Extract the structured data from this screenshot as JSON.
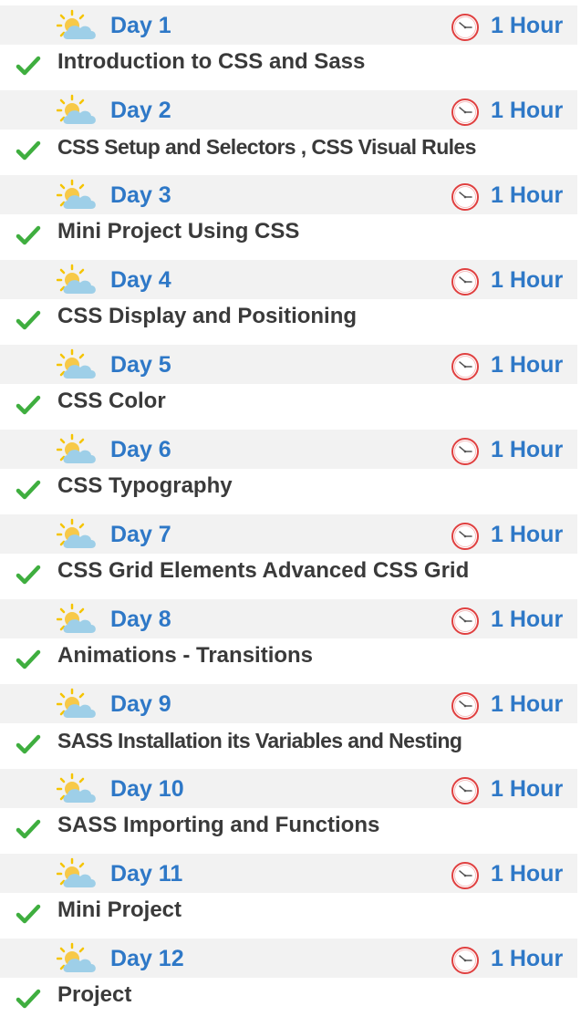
{
  "colors": {
    "accent": "#2e78c7",
    "header_bg": "#f2f2f2",
    "check": "#3fae3f",
    "clock": "#e04040",
    "text": "#3a3a3a"
  },
  "icons": {
    "weather": "sun-behind-cloud-icon",
    "time": "clock-icon",
    "done": "checkmark-icon"
  },
  "days": [
    {
      "label": "Day 1",
      "duration": "1 Hour",
      "topic": "Introduction to CSS and Sass"
    },
    {
      "label": "Day 2",
      "duration": "1 Hour",
      "topic": "CSS Setup and Selectors , CSS Visual Rules"
    },
    {
      "label": "Day 3",
      "duration": "1 Hour",
      "topic": "Mini Project Using CSS"
    },
    {
      "label": "Day 4",
      "duration": "1 Hour",
      "topic": "CSS Display and Positioning"
    },
    {
      "label": "Day 5",
      "duration": "1 Hour",
      "topic": "CSS Color"
    },
    {
      "label": "Day 6",
      "duration": "1 Hour",
      "topic": "CSS Typography"
    },
    {
      "label": "Day 7",
      "duration": "1 Hour",
      "topic": "CSS Grid Elements Advanced CSS Grid"
    },
    {
      "label": "Day 8",
      "duration": "1 Hour",
      "topic": "Animations - Transitions"
    },
    {
      "label": "Day 9",
      "duration": "1 Hour",
      "topic": "SASS Installation its Variables and Nesting"
    },
    {
      "label": "Day 10",
      "duration": "1 Hour",
      "topic": "SASS Importing and Functions"
    },
    {
      "label": "Day 11",
      "duration": "1 Hour",
      "topic": "Mini Project"
    },
    {
      "label": "Day 12",
      "duration": "1 Hour",
      "topic": "Project"
    }
  ]
}
